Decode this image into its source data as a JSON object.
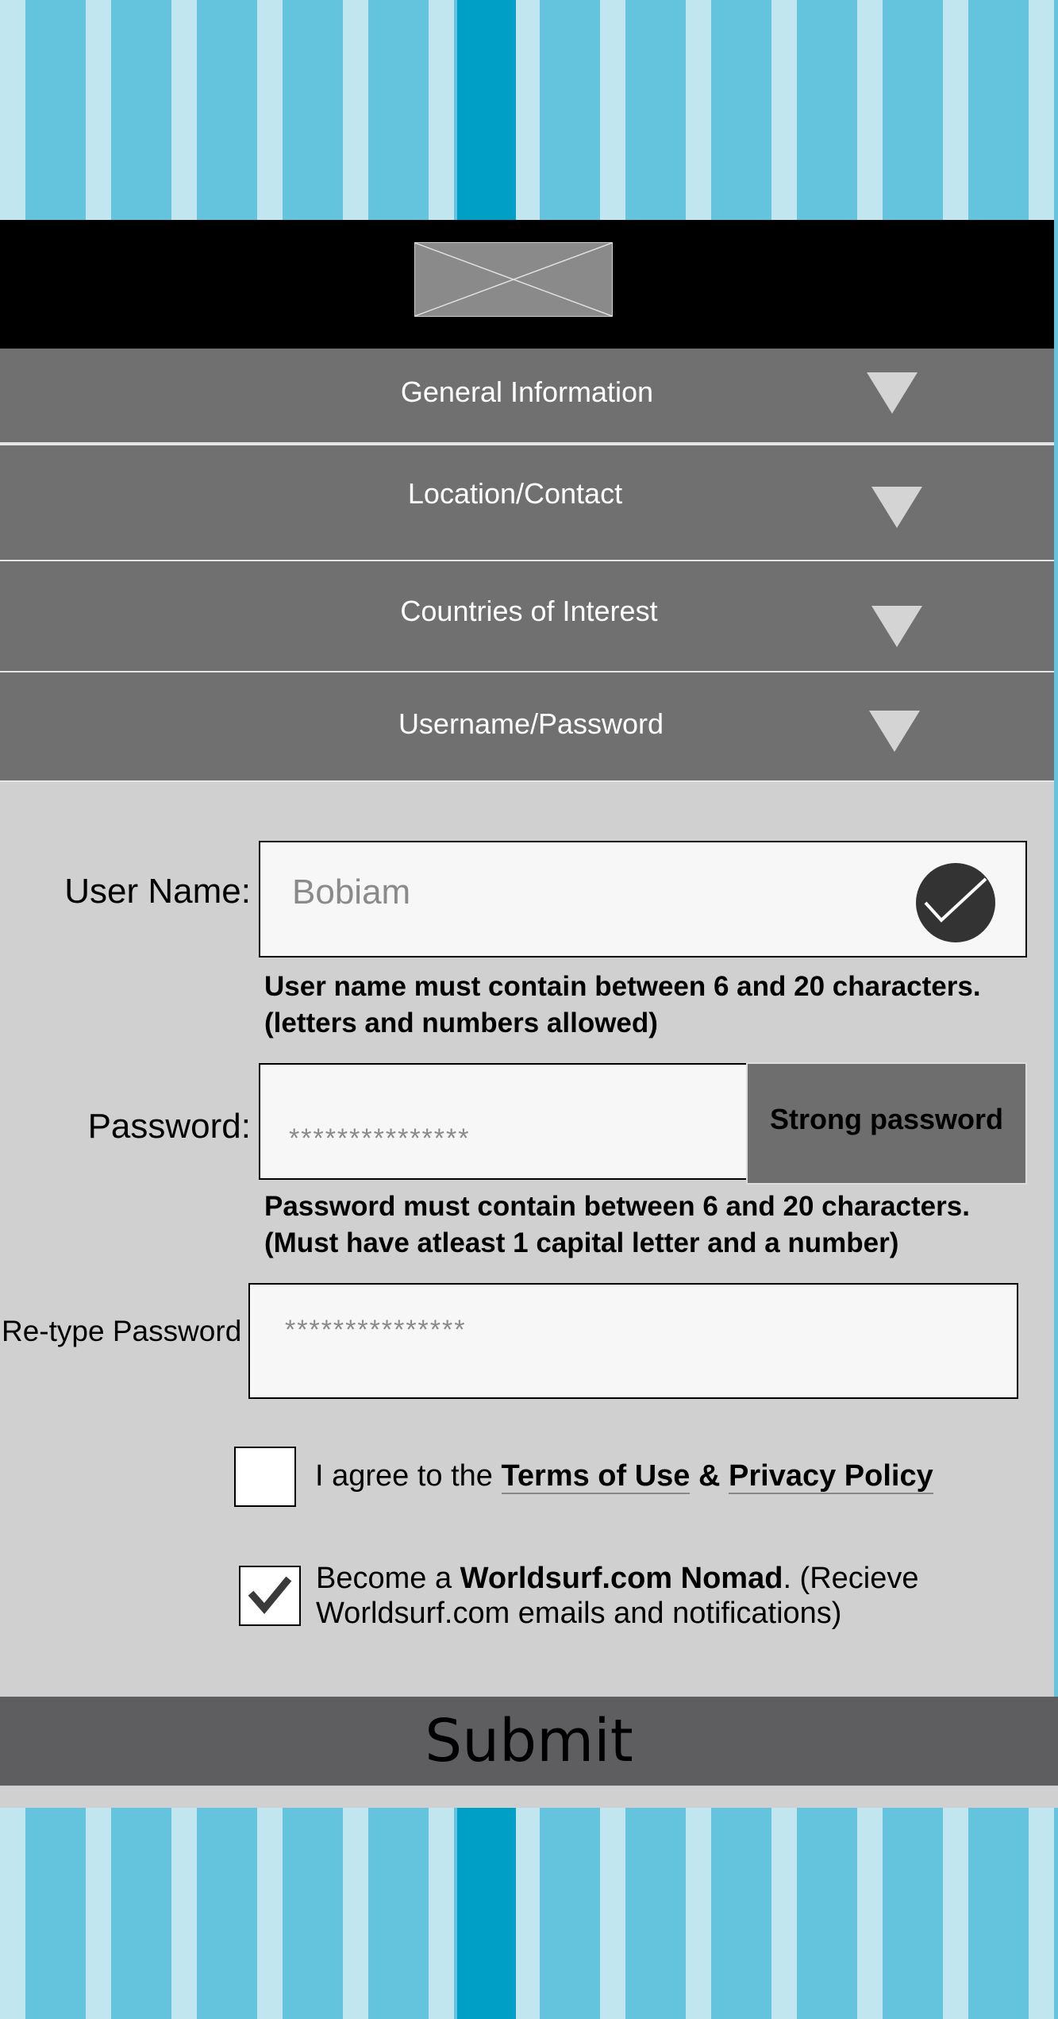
{
  "sections": [
    {
      "label": "General Information"
    },
    {
      "label": "Location/Contact"
    },
    {
      "label": "Countries of Interest"
    },
    {
      "label": "Username/Password"
    }
  ],
  "form": {
    "username": {
      "label": "User Name:",
      "value": "Bobiam",
      "valid": true,
      "help_line1": "User name must contain between 6 and 20 characters.",
      "help_line2": "(letters and numbers allowed)"
    },
    "password": {
      "label": "Password:",
      "value": "***************",
      "strength": "Strong password",
      "help_line1": "Password must contain between 6 and 20 characters.",
      "help_line2": "(Must have atleast 1 capital letter and a number)"
    },
    "retype": {
      "label": "Re-type Password",
      "value": "***************"
    },
    "agree": {
      "checked": false,
      "prefix": "I agree to the ",
      "terms_link": "Terms of Use",
      "amp": " & ",
      "privacy_link": "Privacy Policy"
    },
    "nomad": {
      "checked": true,
      "prefix": "Become a ",
      "brand": "Worldsurf.com Nomad",
      "suffix": ". (Recieve Worldsurf.com emails and notifications)"
    },
    "submit_label": "Submit"
  },
  "colors": {
    "stripe_light": "#c2e6f0",
    "stripe_mid": "#64c3dd",
    "stripe_dark": "#00a0c6",
    "accordion": "#707070",
    "submit": "#5e5e60"
  },
  "icons": {
    "logo": "image-placeholder-icon",
    "dropdown": "triangle-down-icon",
    "valid": "checkmark-circle-icon",
    "checked": "checkmark-icon"
  }
}
